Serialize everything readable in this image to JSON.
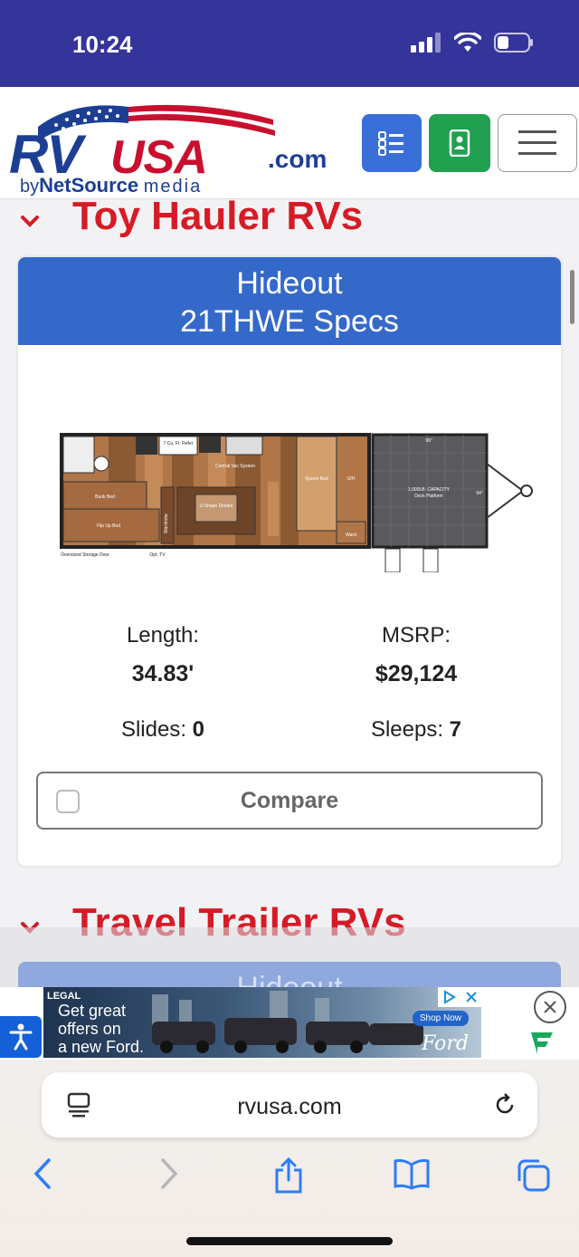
{
  "status_bar": {
    "time": "10:24"
  },
  "header": {
    "logo": {
      "rv": "RV",
      "usa": "USA",
      "com": ".com",
      "by": "by",
      "netsource": "NetSource",
      "media": "media"
    },
    "buttons": [
      "list-icon",
      "phone-icon",
      "menu-icon"
    ]
  },
  "sections": [
    {
      "title": "Toy Hauler RVs"
    },
    {
      "title": "Travel Trailer RVs"
    }
  ],
  "card": {
    "title_line1": "Hideout",
    "title_line2": "21THWE Specs",
    "floorplan_labels": {
      "refer": "7 Cu. Ft. Refer",
      "central_vac": "Central Vac System",
      "queen_bed": "Queen Bed",
      "oh": "O/H",
      "bunk_bed": "Bunk Bed",
      "flip_up_bed": "Flip Up Bed",
      "wardrobe": "Wardrobe",
      "u_shape_dinette": "U-Shape Dinette",
      "ward": "Ward",
      "capacity": "1,000LB. CAPACITY",
      "deck_platform": "Deck Platform",
      "width_top": "99\"",
      "width_side": "94\"",
      "storage_door": "Oversized Storage Door",
      "opt_tv": "Opt. TV"
    },
    "length_label": "Length:",
    "length_value": "34.83'",
    "msrp_label": "MSRP:",
    "msrp_value": "$29,124",
    "slides_label": "Slides: ",
    "slides_value": "0",
    "sleeps_label": "Sleeps: ",
    "sleeps_value": "7",
    "compare_label": "Compare",
    "compare_checked": false
  },
  "card2": {
    "title": "Hideout"
  },
  "ad": {
    "legal": "LEGAL",
    "text_line1": "Get great",
    "text_line2": "offers on",
    "text_line3": "a new Ford.",
    "shop_now": "Shop Now",
    "brand": "Ford"
  },
  "browser": {
    "url": "rvusa.com"
  },
  "colors": {
    "status_bar": "#34349a",
    "accent_red": "#d61b26",
    "card_header": "#3469ca",
    "btn_blue": "#3a6fd8",
    "btn_green": "#21a050"
  }
}
